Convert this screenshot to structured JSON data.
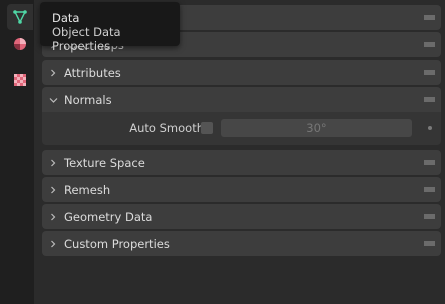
{
  "tabs": [
    {
      "name": "data",
      "icon": "object-data-icon",
      "color": "#4fd7a6",
      "active": true
    },
    {
      "name": "material",
      "icon": "material-icon",
      "color": "#e0667a",
      "active": false
    },
    {
      "name": "texture",
      "icon": "texture-icon",
      "color": "#e0667a",
      "active": false
    }
  ],
  "tooltip": {
    "title": "Data",
    "subtitle": "Object Data Properties"
  },
  "panels": [
    {
      "id": "vertex_groups",
      "label": "",
      "expanded": false
    },
    {
      "id": "face_maps",
      "label": "Face Maps",
      "expanded": false
    },
    {
      "id": "attributes",
      "label": "Attributes",
      "expanded": false
    },
    {
      "id": "normals",
      "label": "Normals",
      "expanded": true
    },
    {
      "id": "texture_space",
      "label": "Texture Space",
      "expanded": false
    },
    {
      "id": "remesh",
      "label": "Remesh",
      "expanded": false
    },
    {
      "id": "geometry_data",
      "label": "Geometry Data",
      "expanded": false
    },
    {
      "id": "custom_properties",
      "label": "Custom Properties",
      "expanded": false
    }
  ],
  "normals": {
    "auto_smooth_label": "Auto Smooth",
    "auto_smooth_checked": false,
    "angle_value": "30°"
  }
}
